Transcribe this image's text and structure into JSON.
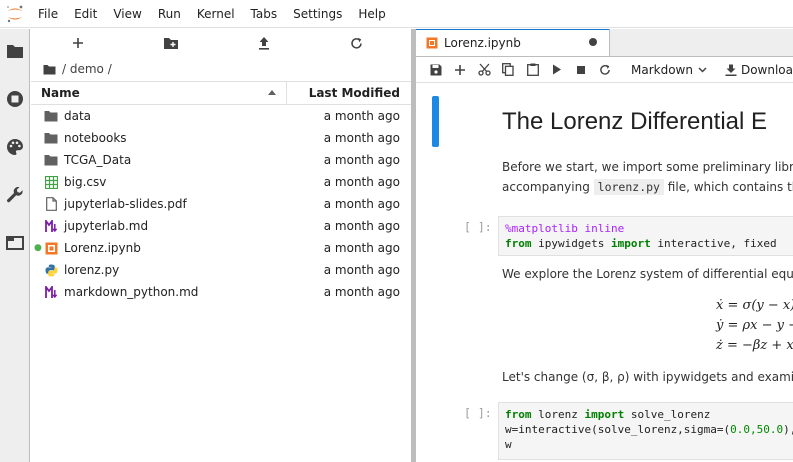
{
  "menubar": {
    "items": [
      "File",
      "Edit",
      "View",
      "Run",
      "Kernel",
      "Tabs",
      "Settings",
      "Help"
    ]
  },
  "filebrowser": {
    "breadcrumb": "/ demo /",
    "columns": {
      "name": "Name",
      "modified": "Last Modified"
    },
    "files": [
      {
        "name": "data",
        "type": "folder",
        "modified": "a month ago"
      },
      {
        "name": "notebooks",
        "type": "folder",
        "modified": "a month ago"
      },
      {
        "name": "TCGA_Data",
        "type": "folder",
        "modified": "a month ago"
      },
      {
        "name": "big.csv",
        "type": "csv",
        "modified": "a month ago"
      },
      {
        "name": "jupyterlab-slides.pdf",
        "type": "pdf",
        "modified": "a month ago"
      },
      {
        "name": "jupyterlab.md",
        "type": "markdown",
        "modified": "a month ago"
      },
      {
        "name": "Lorenz.ipynb",
        "type": "notebook",
        "modified": "a month ago",
        "running": true
      },
      {
        "name": "lorenz.py",
        "type": "python",
        "modified": "a month ago"
      },
      {
        "name": "markdown_python.md",
        "type": "markdown",
        "modified": "a month ago"
      }
    ]
  },
  "editor": {
    "tab_label": "Lorenz.ipynb",
    "cell_type": "Markdown",
    "download_label": "Downloa",
    "title": "The Lorenz Differential E",
    "intro_line1": "Before we start, we import some preliminary librarie",
    "intro_line2_pre": "accompanying",
    "intro_line2_code": "lorenz.py",
    "intro_line2_post": "file, which contains the",
    "cell1_prompt": "[ ]:",
    "cell1_line1_magic": "%matplotlib inline",
    "cell1_line2_kw1": "from",
    "cell1_line2_mod": " ipywidgets ",
    "cell1_line2_kw2": "import",
    "cell1_line2_rest": " interactive, fixed",
    "explore_text": "We explore the Lorenz system of differential equatio",
    "eq1": "ẋ = σ(y − x)",
    "eq2": "ẏ = ρx − y −",
    "eq3": "ż = −βz + x",
    "change_text": "Let's change (σ, β, ρ) with ipywidgets and examine t",
    "cell2_prompt": "[ ]:",
    "cell2_line1_kw1": "from",
    "cell2_line1_mod": " lorenz ",
    "cell2_line1_kw2": "import",
    "cell2_line1_rest": " solve_lorenz",
    "cell2_line2_pre": "w=interactive(solve_lorenz,sigma=(",
    "cell2_line2_num": "0.0,50.0",
    "cell2_line2_post": "),r",
    "cell2_line3": "w"
  },
  "colors": {
    "accent": "#1976d2",
    "active_cell": "#1e88e5",
    "jupyter_orange": "#f37726",
    "code_keyword": "#008000"
  }
}
